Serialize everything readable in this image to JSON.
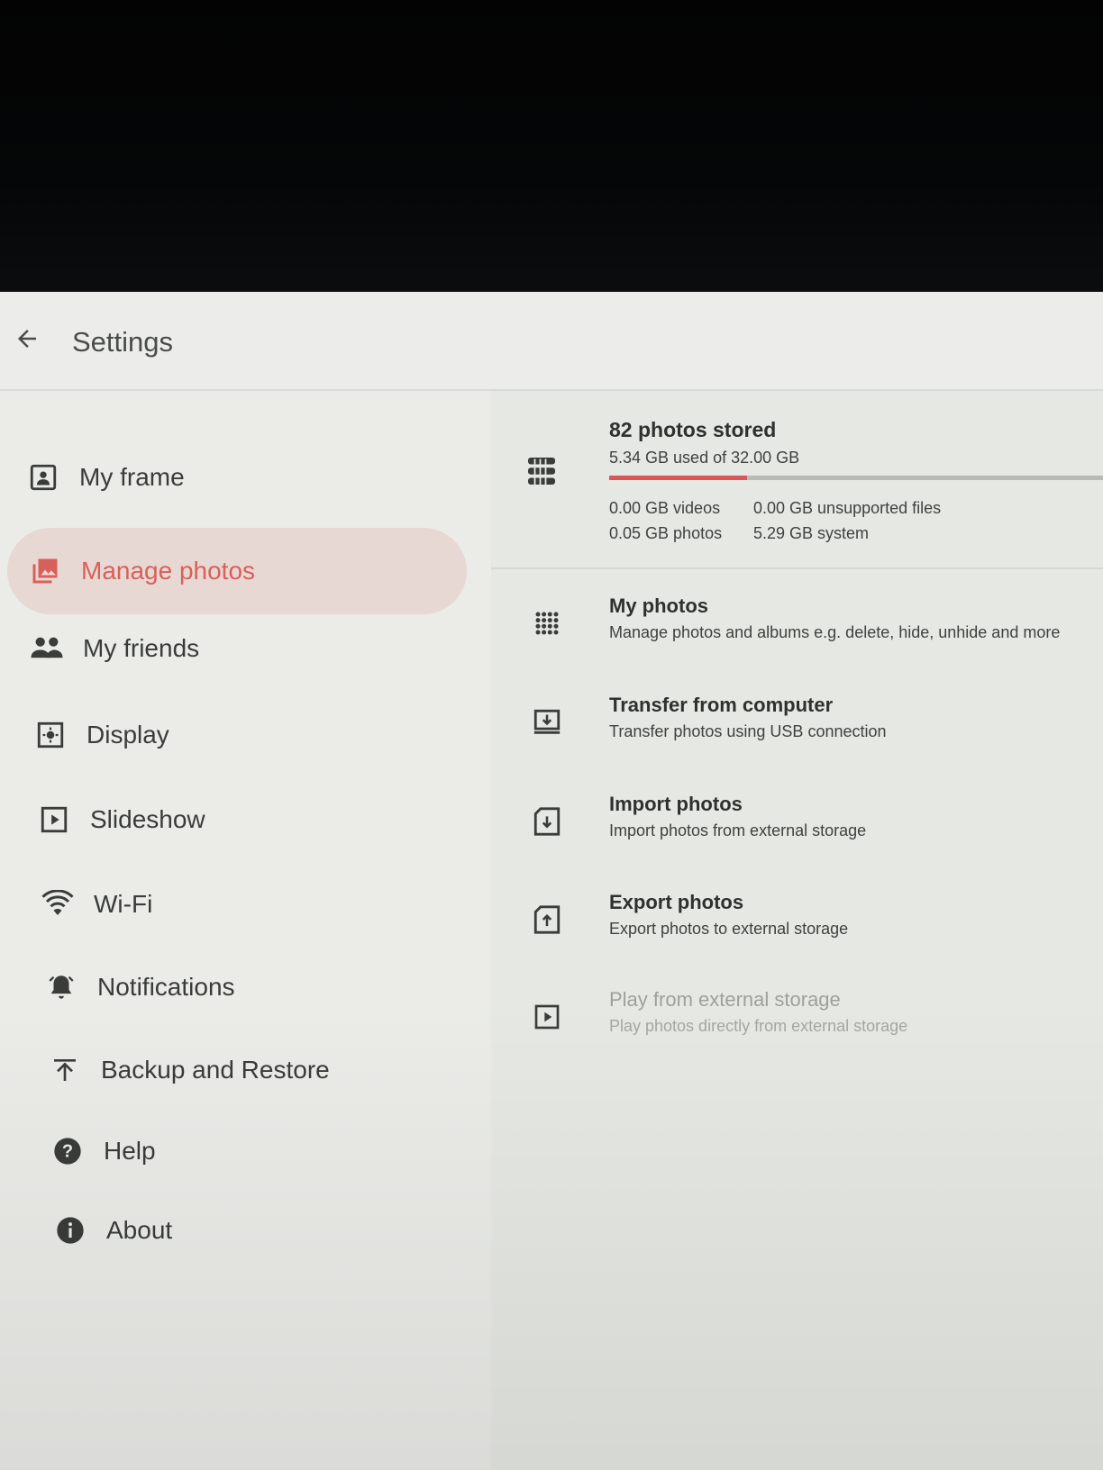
{
  "header": {
    "title": "Settings"
  },
  "sidebar": {
    "items": [
      {
        "label": "My frame",
        "icon": "portrait-frame-icon"
      },
      {
        "label": "Manage photos",
        "icon": "photo-library-icon",
        "active": true
      },
      {
        "label": "My friends",
        "icon": "people-icon"
      },
      {
        "label": "Display",
        "icon": "display-brightness-icon"
      },
      {
        "label": "Slideshow",
        "icon": "slideshow-play-icon"
      },
      {
        "label": "Wi-Fi",
        "icon": "wifi-icon"
      },
      {
        "label": "Notifications",
        "icon": "bell-icon"
      },
      {
        "label": "Backup and Restore",
        "icon": "upload-icon"
      },
      {
        "label": "Help",
        "icon": "help-icon"
      },
      {
        "label": "About",
        "icon": "info-icon"
      }
    ]
  },
  "storage": {
    "title": "82 photos stored",
    "used": "5.34 GB used of 32.00 GB",
    "used_fraction": 0.167,
    "videos": "0.00 GB videos",
    "photos": "0.05 GB photos",
    "unsupported": "0.00 GB unsupported files",
    "system": "5.29 GB system"
  },
  "options": [
    {
      "title": "My photos",
      "subtitle": "Manage photos and albums e.g. delete, hide, unhide and more",
      "icon": "grid-icon"
    },
    {
      "title": "Transfer from computer",
      "subtitle": "Transfer photos using USB connection",
      "icon": "usb-transfer-icon"
    },
    {
      "title": "Import photos",
      "subtitle": "Import photos from external storage",
      "icon": "import-icon"
    },
    {
      "title": "Export photos",
      "subtitle": "Export photos to external storage",
      "icon": "export-icon"
    },
    {
      "title": "Play from external storage",
      "subtitle": "Play photos directly from external storage",
      "icon": "play-icon",
      "disabled": true
    }
  ],
  "colors": {
    "accent": "#d8605a",
    "active_bg": "#e8d8d3",
    "progress": "#d9575a"
  }
}
